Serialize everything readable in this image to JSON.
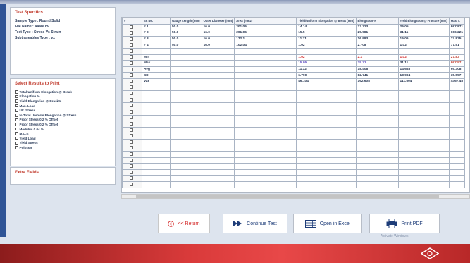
{
  "spec_panel": {
    "title": "Test Specifics",
    "lines": [
      "Sample Type : Round Solid",
      "File Name : Aaabi.nv",
      "Test Type : Stress Vs Strain",
      "Subtraseables Type : vx"
    ]
  },
  "results_panel": {
    "title": "Select Results to Print",
    "items": [
      "Total Uniform Elongation @ Break",
      "Elongation %",
      "Yield Elongation @ Break%",
      "Max. Load",
      "Ult. Stress",
      "% Total Uniform Elongation @ Stress",
      "Proof Stress 0.2 % Offset",
      "Proof Stress 0.2 % Offset",
      "Modulus 0.04 %",
      "M.O.E",
      "Yield Load",
      "Yield Stress",
      "Poisson"
    ]
  },
  "extra_panel": {
    "title": "Extra Fields"
  },
  "grid": {
    "columns": [
      "Sr. No.",
      "Gauge Length (mm)",
      "Outer Diameter (mm)",
      "Area (mm2)",
      "Yield/Uniform Elongation @ Break (mm)",
      "Elongation %",
      "Yield Elongation @ Fracture (mm)",
      "Max. L"
    ],
    "data_rows": [
      [
        "# 1.",
        "50.0",
        "16.0",
        "201.06",
        "14.14",
        "23.723",
        "26.05",
        "997.871"
      ],
      [
        "# 2.",
        "50.0",
        "16.0",
        "201.06",
        "15.5",
        "25.981",
        "31.11",
        "606.221"
      ],
      [
        "# 3.",
        "50.0",
        "16.0",
        "172.1",
        "11.71",
        "16.983",
        "15.06",
        "27.825"
      ],
      [
        "# 4.",
        "50.0",
        "16.0",
        "102.04",
        "1.02",
        "2.708",
        "1.02",
        "77.51"
      ]
    ],
    "stat_rows": [
      [
        "Min",
        "",
        "",
        "",
        "1.02",
        "2.1",
        "1.02",
        "27.83"
      ],
      [
        "Max",
        "",
        "",
        "",
        "15.05",
        "25.71",
        "31.11",
        "997.57"
      ],
      [
        "Avg",
        "",
        "",
        "",
        "11.32",
        "18.408",
        "14.653",
        "95.308"
      ],
      [
        "SD",
        "",
        "",
        "",
        "6.790",
        "12.741",
        "18.994",
        "35.557"
      ],
      [
        "Var",
        "",
        "",
        "",
        "46.104",
        "162.608",
        "111.594",
        "4467.45"
      ]
    ]
  },
  "buttons": {
    "return": "<< Return",
    "continue": "Continue Test",
    "excel": "Open in Excel",
    "print": "Print PDF"
  },
  "watermark": "Activate Windows",
  "colors": {
    "accent_blue": "#2f5496",
    "title_red": "#c0392b",
    "footer_red": "#d93a3a"
  }
}
